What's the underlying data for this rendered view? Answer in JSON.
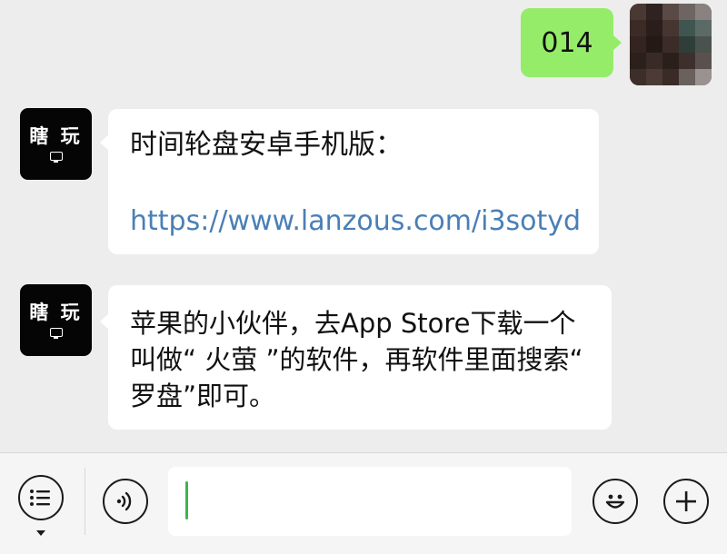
{
  "messages": {
    "outgoing": {
      "text": "014"
    },
    "bot_avatar": {
      "name": "瞎 玩",
      "icon": "tv-icon"
    },
    "incoming_1": {
      "line1": "时间轮盘安卓手机版：",
      "link": "https://www.lanzous.com/i3sotyd"
    },
    "incoming_2": {
      "text": "苹果的小伙伴，去App Store下载一个叫做“ 火萤 ”的软件，再软件里面搜索“ 罗盘”即可。"
    }
  },
  "input_bar": {
    "left_icons": [
      "menu-icon",
      "voice-icon"
    ],
    "right_icons": [
      "emoji-icon",
      "plus-icon"
    ],
    "input_value": ""
  },
  "colors": {
    "outgoing_bubble": "#95ec69",
    "link": "#4a7fb5",
    "cursor": "#3cb64a",
    "background": "#ededed"
  }
}
